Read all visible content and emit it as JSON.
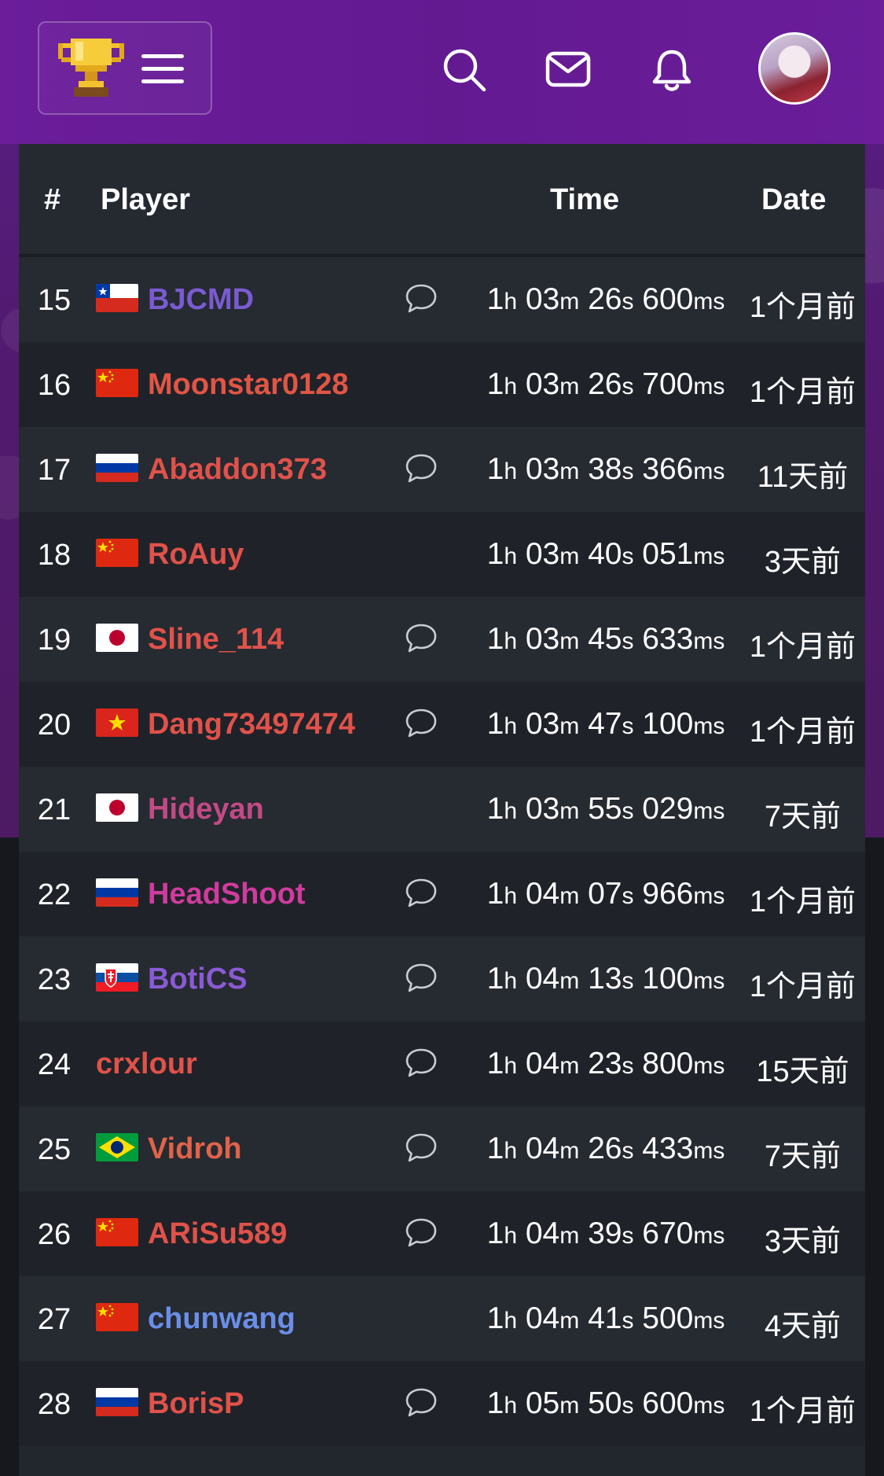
{
  "header": {
    "menu_icon": "hamburger-icon",
    "logo_icon": "trophy-icon",
    "actions": [
      "search-icon",
      "mail-icon",
      "bell-icon",
      "avatar"
    ]
  },
  "table": {
    "headers": {
      "rank": "#",
      "player": "Player",
      "time": "Time",
      "date": "Date"
    },
    "rows": [
      {
        "rank": "15",
        "flag": "cl",
        "name": "BJCMD",
        "color": "#7a5bd1",
        "comment": true,
        "time": {
          "h": "1",
          "m": "03",
          "s": "26",
          "ms": "600"
        },
        "date": "1个月前"
      },
      {
        "rank": "16",
        "flag": "cn",
        "name": "Moonstar0128",
        "color": "#e25545",
        "comment": false,
        "time": {
          "h": "1",
          "m": "03",
          "s": "26",
          "ms": "700"
        },
        "date": "1个月前"
      },
      {
        "rank": "17",
        "flag": "ru",
        "name": "Abaddon373",
        "color": "#e0524a",
        "comment": true,
        "time": {
          "h": "1",
          "m": "03",
          "s": "38",
          "ms": "366"
        },
        "date": "11天前"
      },
      {
        "rank": "18",
        "flag": "cn",
        "name": "RoAuy",
        "color": "#e0524a",
        "comment": false,
        "time": {
          "h": "1",
          "m": "03",
          "s": "40",
          "ms": "051"
        },
        "date": "3天前"
      },
      {
        "rank": "19",
        "flag": "jp",
        "name": "Sline_114",
        "color": "#e0524a",
        "comment": true,
        "time": {
          "h": "1",
          "m": "03",
          "s": "45",
          "ms": "633"
        },
        "date": "1个月前"
      },
      {
        "rank": "20",
        "flag": "vn",
        "name": "Dang73497474",
        "color": "#e0524a",
        "comment": true,
        "time": {
          "h": "1",
          "m": "03",
          "s": "47",
          "ms": "100"
        },
        "date": "1个月前"
      },
      {
        "rank": "21",
        "flag": "jp",
        "name": "Hideyan",
        "color": "#c24a86",
        "comment": false,
        "time": {
          "h": "1",
          "m": "03",
          "s": "55",
          "ms": "029"
        },
        "date": "7天前"
      },
      {
        "rank": "22",
        "flag": "ru",
        "name": "HeadShoot",
        "color": "#d03b9e",
        "comment": true,
        "time": {
          "h": "1",
          "m": "04",
          "s": "07",
          "ms": "966"
        },
        "date": "1个月前"
      },
      {
        "rank": "23",
        "flag": "sk",
        "name": "BotiCS",
        "color": "#8a5ad3",
        "comment": true,
        "time": {
          "h": "1",
          "m": "04",
          "s": "13",
          "ms": "100"
        },
        "date": "1个月前"
      },
      {
        "rank": "24",
        "flag": "",
        "name": "crxlour",
        "color": "#e0524a",
        "comment": true,
        "time": {
          "h": "1",
          "m": "04",
          "s": "23",
          "ms": "800"
        },
        "date": "15天前"
      },
      {
        "rank": "25",
        "flag": "br",
        "name": "Vidroh",
        "color": "#e0634a",
        "comment": true,
        "time": {
          "h": "1",
          "m": "04",
          "s": "26",
          "ms": "433"
        },
        "date": "7天前"
      },
      {
        "rank": "26",
        "flag": "cn",
        "name": "ARiSu589",
        "color": "#e0524a",
        "comment": true,
        "time": {
          "h": "1",
          "m": "04",
          "s": "39",
          "ms": "670"
        },
        "date": "3天前"
      },
      {
        "rank": "27",
        "flag": "cn",
        "name": "chunwang",
        "color": "#6a8ee8",
        "comment": false,
        "time": {
          "h": "1",
          "m": "04",
          "s": "41",
          "ms": "500"
        },
        "date": "4天前"
      },
      {
        "rank": "28",
        "flag": "ru",
        "name": "BorisP",
        "color": "#e0524a",
        "comment": true,
        "time": {
          "h": "1",
          "m": "05",
          "s": "50",
          "ms": "600"
        },
        "date": "1个月前"
      }
    ]
  }
}
